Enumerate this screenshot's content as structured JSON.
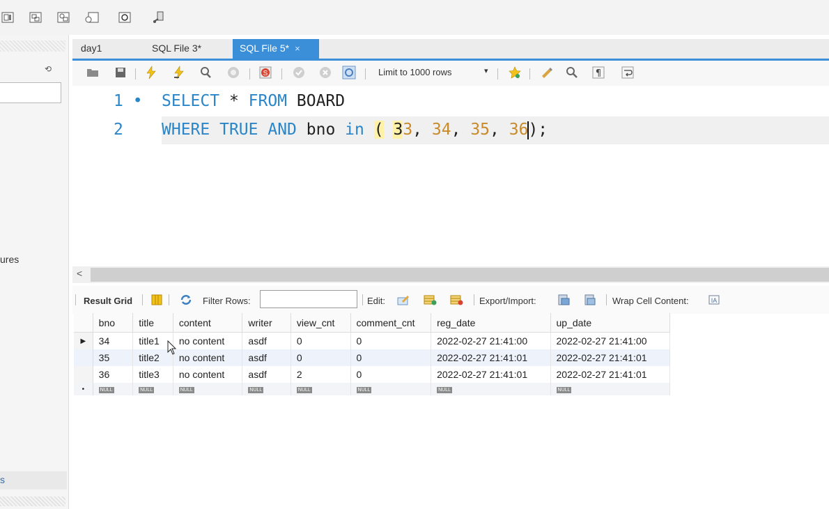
{
  "tabs": [
    {
      "label": "day1",
      "active": false
    },
    {
      "label": "SQL File 3*",
      "active": false
    },
    {
      "label": "SQL File 5*",
      "active": true,
      "close": "×"
    }
  ],
  "left_panel": {
    "partial_label": "ures",
    "bottom_tab_partial": "s"
  },
  "editor_toolbar": {
    "limit_label": "Limit to 1000 rows",
    "dropdown_arrow": "▾"
  },
  "editor": {
    "lines": [
      {
        "number": "1",
        "marker": "•",
        "tokens": [
          "SELECT",
          "*",
          "FROM",
          "BOARD"
        ]
      },
      {
        "number": "2",
        "marker": "",
        "tokens": [
          "WHERE",
          "TRUE",
          "AND",
          "bno",
          "in",
          "(",
          "33",
          ",",
          "34",
          ",",
          "35",
          ",",
          "36",
          ")",
          ";"
        ]
      }
    ],
    "l1_kw1": "SELECT",
    "l1_star": " * ",
    "l1_kw2": "FROM",
    "l1_ident": " BOARD",
    "l2_kw1": "WHERE",
    "l2_kw2": "TRUE",
    "l2_kw3": "AND",
    "l2_ident": "bno",
    "l2_kw4": "in",
    "l2_open": "(",
    "l2_n1a": "3",
    "l2_n1b": "3",
    "l2_n2": "34",
    "l2_n3": "35",
    "l2_n4": "36",
    "l2_comma": ",",
    "l2_close": ");",
    "scroll_arrow": "<"
  },
  "result_toolbar": {
    "result_grid": "Result Grid",
    "filter_rows": "Filter Rows:",
    "edit": "Edit:",
    "export_import": "Export/Import:",
    "wrap_cell": "Wrap Cell Content:"
  },
  "grid": {
    "columns": [
      "bno",
      "title",
      "content",
      "writer",
      "view_cnt",
      "comment_cnt",
      "reg_date",
      "up_date"
    ],
    "rows": [
      [
        "34",
        "title1",
        "no content",
        "asdf",
        "0",
        "0",
        "2022-02-27 21:41:00",
        "2022-02-27 21:41:00"
      ],
      [
        "35",
        "title2",
        "no content",
        "asdf",
        "0",
        "0",
        "2022-02-27 21:41:01",
        "2022-02-27 21:41:01"
      ],
      [
        "36",
        "title3",
        "no content",
        "asdf",
        "2",
        "0",
        "2022-02-27 21:41:01",
        "2022-02-27 21:41:01"
      ]
    ],
    "null_label": "NULL",
    "current_row_marker": "▶",
    "new_row_marker": "•"
  },
  "colors": {
    "accent": "#3b8fd9",
    "keyword": "#2a86c9",
    "number": "#c98a2a"
  },
  "icons": [
    "schema-icon",
    "new-tab-icon",
    "open-file-icon",
    "save-icon",
    "execute-icon",
    "execute-current-icon",
    "explain-icon",
    "stop-icon",
    "toggle-error-icon",
    "commit-icon",
    "rollback-icon",
    "autocommit-icon",
    "bookmark-icon",
    "beautify-icon",
    "find-icon",
    "invisibles-icon",
    "wrap-icon",
    "refresh-icon",
    "grid-layout-icon"
  ]
}
